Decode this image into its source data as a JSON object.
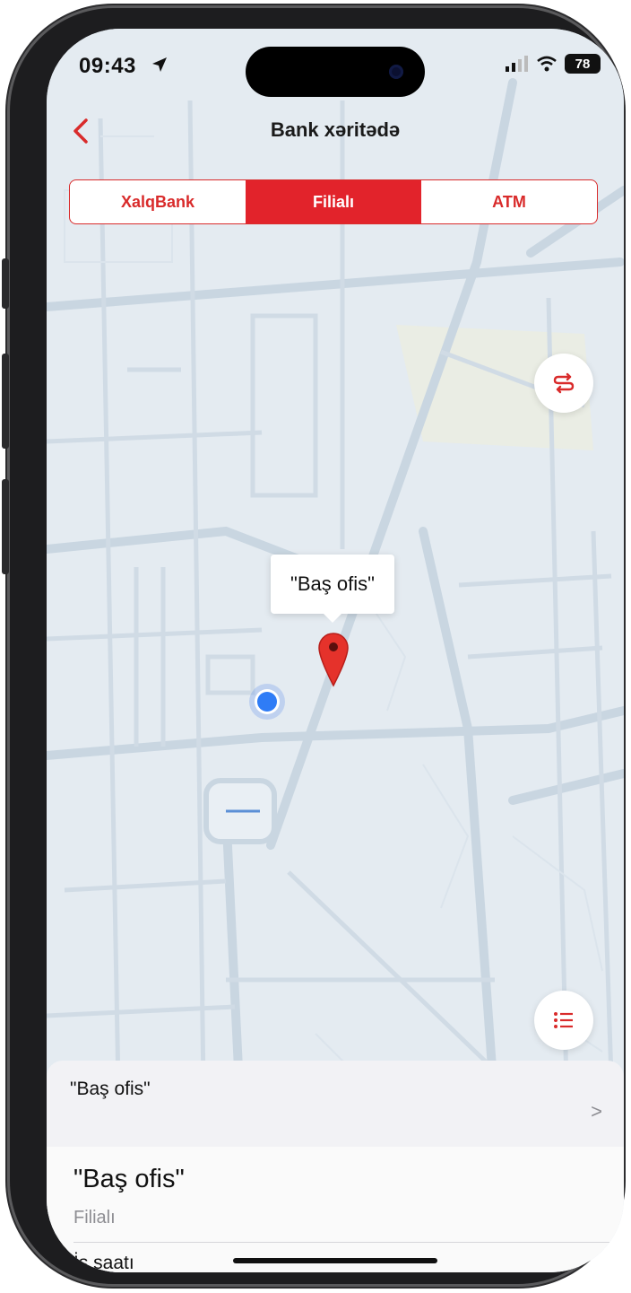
{
  "status_bar": {
    "time": "09:43",
    "battery": "78",
    "icons": [
      "location-arrow-icon",
      "signal-icon",
      "wifi-icon",
      "battery-icon"
    ]
  },
  "nav": {
    "title": "Bank xəritədə",
    "back_icon": "chevron-left-icon"
  },
  "segments": [
    {
      "label": "XalqBank",
      "active": false
    },
    {
      "label": "Filialı",
      "active": true
    },
    {
      "label": "ATM",
      "active": false
    }
  ],
  "map": {
    "marker_callout": "\"Baş ofis\"",
    "route_button_icon": "route-icon",
    "list_button_icon": "list-icon"
  },
  "sheet": {
    "header_title": "\"Baş ofis\"",
    "chevron": ">"
  },
  "detail": {
    "name": "\"Baş ofis\"",
    "type": "Filialı",
    "row_label": "İş saatı"
  },
  "colors": {
    "accent": "#e2232b",
    "map_bg": "#e4ebf1",
    "road": "#c9d6e1",
    "user_location": "#2f7cf6"
  }
}
